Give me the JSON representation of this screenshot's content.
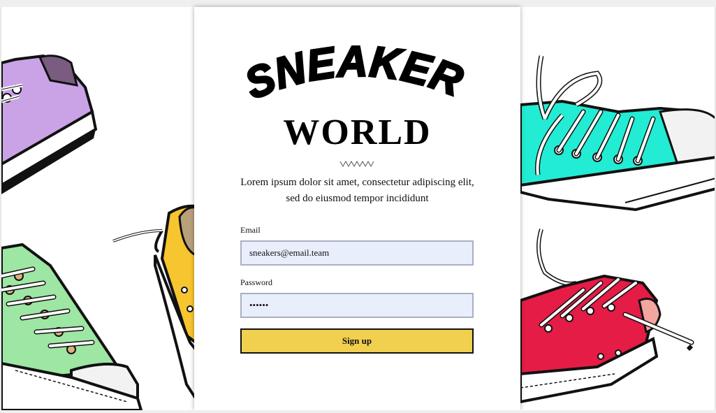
{
  "brand": {
    "logo_text": "SNEAKER",
    "subtitle": "WORLD"
  },
  "intro": {
    "text": "Lorem ipsum dolor sit amet, consectetur adipiscing elit, sed do eiusmod tempor incididunt"
  },
  "form": {
    "email_label": "Email",
    "email_value": "sneakers@email.team",
    "password_label": "Password",
    "password_value": "••••••",
    "submit_label": "Sign up"
  },
  "colors": {
    "button": "#f0d04e",
    "field_bg": "#e8eefc",
    "sneaker_purple": "#c9a3e6",
    "sneaker_yellow": "#f7c52f",
    "sneaker_green": "#9de6a4",
    "sneaker_teal": "#22ecd4",
    "sneaker_red": "#e51c45"
  },
  "icons": {
    "squiggle": "wavy-divider-icon",
    "decor": [
      "sneaker-purple",
      "sneaker-yellow",
      "sneaker-green",
      "sneaker-teal",
      "sneaker-red"
    ]
  }
}
